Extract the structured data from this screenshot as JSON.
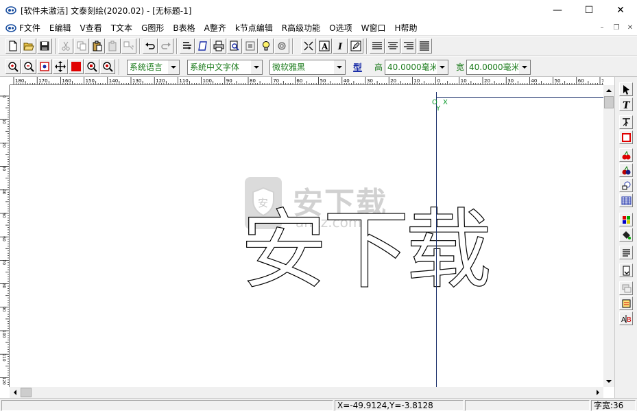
{
  "window": {
    "title": "[软件未激活] 文泰刻绘(2020.02) - [无标题-1]",
    "minimize_glyph": "—",
    "maximize_glyph": "☐",
    "close_glyph": "✕"
  },
  "menu": {
    "items": [
      "F文件",
      "E编辑",
      "V查看",
      "T文本",
      "G图形",
      "B表格",
      "A整齐",
      "k节点编辑",
      "R高级功能",
      "O选项",
      "W窗口",
      "H帮助"
    ],
    "mdi_minimize": "–",
    "mdi_restore": "❐",
    "mdi_close": "✕"
  },
  "toolbar2": {
    "language_combo": "系统语言",
    "charset_combo": "系统中文字体",
    "font_combo": "微软雅黑",
    "shape_button": "型",
    "height_label": "高",
    "height_value": "40.0000毫米",
    "width_label": "宽",
    "width_value": "40.0000毫米"
  },
  "ruler_top_labels": [
    "180",
    "170",
    "160",
    "150",
    "140",
    "130",
    "120",
    "110",
    "100",
    "90",
    "80",
    "70",
    "60",
    "50",
    "40",
    "30",
    "20",
    "10",
    "0",
    "10",
    "20",
    "30",
    "40",
    "50",
    "60",
    "70"
  ],
  "ruler_left_labels": [
    "0",
    "10",
    "20",
    "30",
    "40",
    "50",
    "60",
    "70",
    "80",
    "90",
    "100",
    "110",
    "120"
  ],
  "canvas": {
    "main_text": "安下载",
    "origin_o": "O",
    "origin_x": "X",
    "origin_y": "Y",
    "watermark_text": "安下载",
    "watermark_sub": "anxz.com",
    "watermark_icon_text": "安"
  },
  "statusbar": {
    "coords": "X=-49.9124,Y=-3.8128",
    "char_width": "字宽:36"
  },
  "colors": {
    "toolbar_bg": "#f0f0f0",
    "combo_text": "#1b7b1b",
    "axis_line": "#1a2f6b",
    "origin_green": "#0a9a2a"
  }
}
